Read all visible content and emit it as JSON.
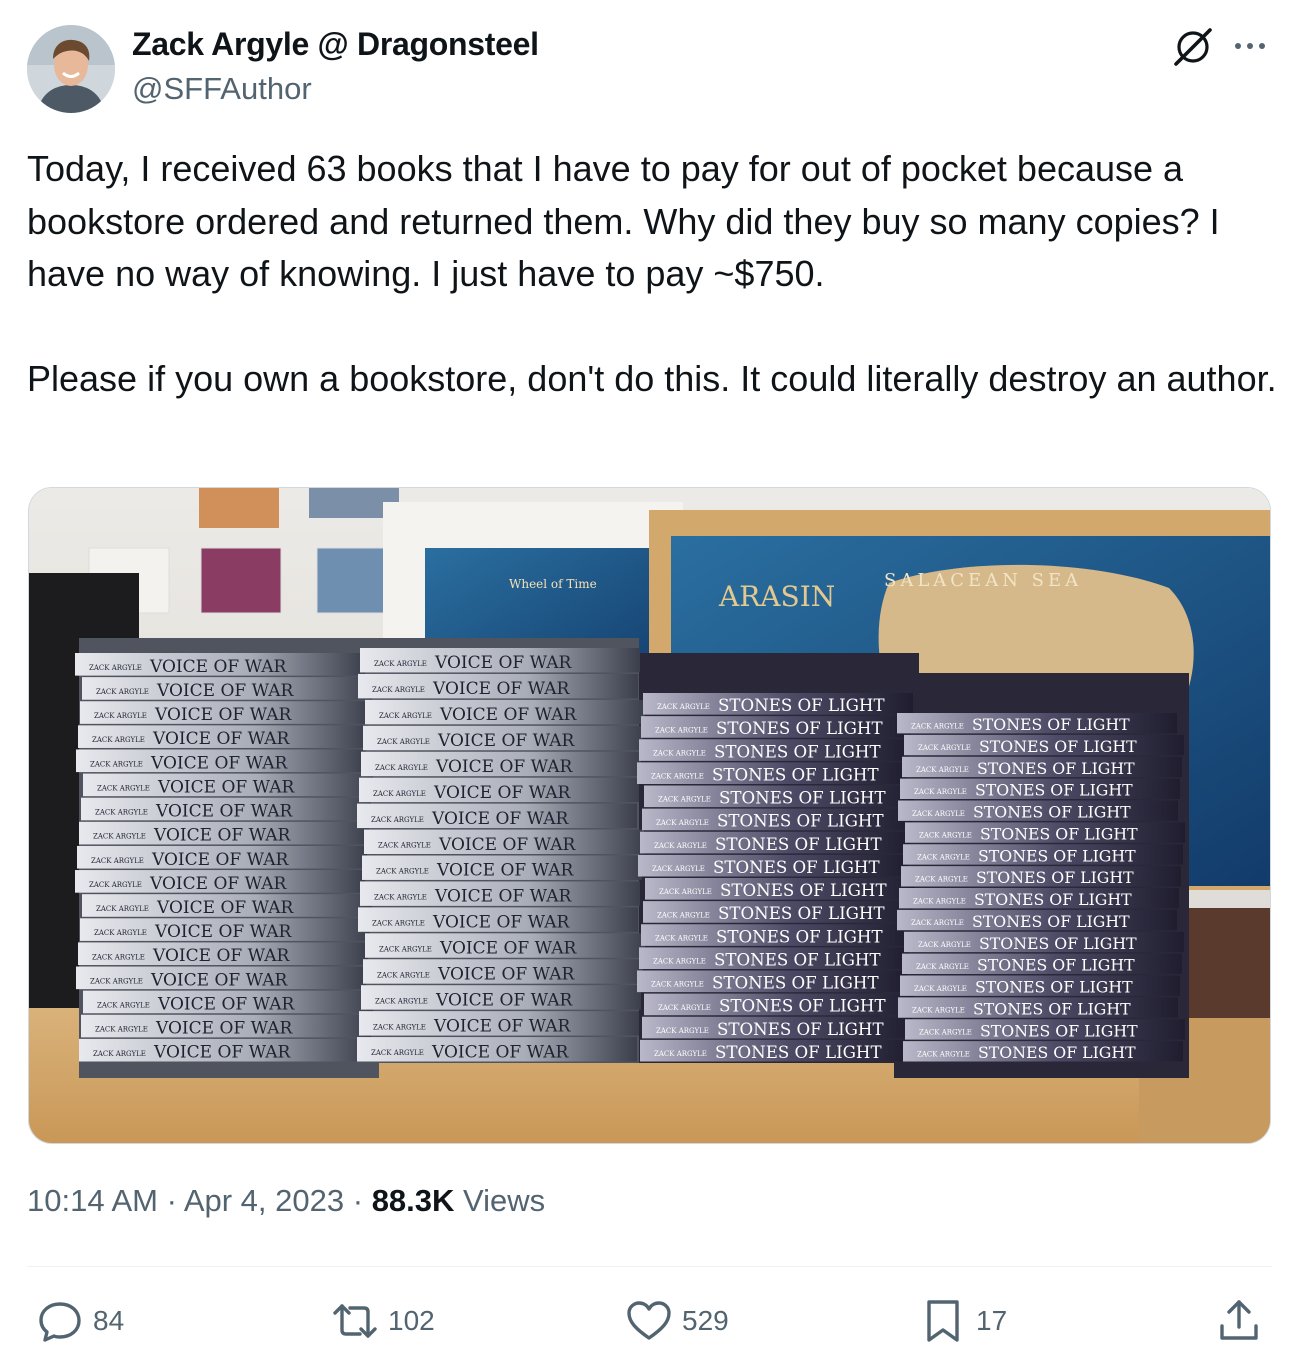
{
  "author": {
    "display_name": "Zack Argyle @ Dragonsteel",
    "handle": "@SFFAuthor"
  },
  "header_icons": [
    "grok-icon",
    "more-icon"
  ],
  "tweet": {
    "text": "Today, I received 63 books that I have to pay for out of pocket because a bookstore ordered and returned them. Why did they buy so many copies? I have no way of knowing. I just have to pay ~$750.\n\nPlease if you own a bookstore, don't do this. It could literally destroy an author."
  },
  "photo": {
    "alt_icon": "photo-stacked-books",
    "spine_labels": {
      "voice": "VOICE OF WAR",
      "stones": "STONES OF LIGHT",
      "author": "ZACK ARGYLE"
    },
    "map_labels": {
      "sea": "SALACEAN SEA",
      "continent": "ARASIN",
      "wheel": "Wheel of Time"
    }
  },
  "meta": {
    "time": "10:14 AM",
    "sep1": " · ",
    "date": "Apr 4, 2023",
    "sep2": " · ",
    "views_count": "88.3K",
    "views_label": " Views"
  },
  "actions": {
    "replies": "84",
    "reposts": "102",
    "likes": "529",
    "bookmarks": "17"
  },
  "colors": {
    "text": "#0f1419",
    "secondary": "#536471",
    "divider": "#eff3f4"
  }
}
